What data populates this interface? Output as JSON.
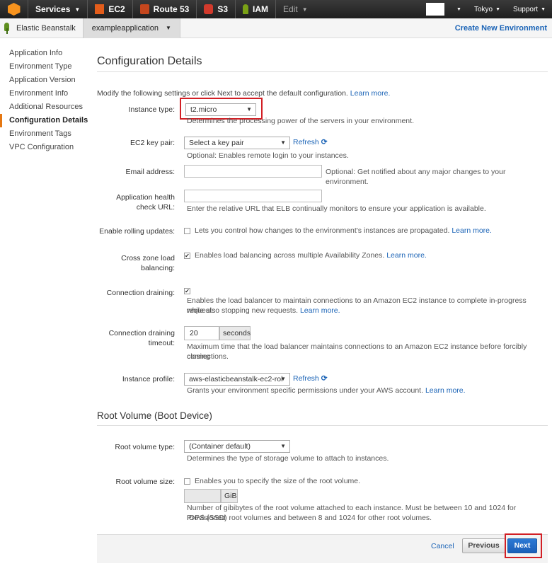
{
  "topnav": {
    "services": "Services",
    "ec2": "EC2",
    "route53": "Route 53",
    "s3": "S3",
    "iam": "IAM",
    "edit": "Edit",
    "region": "Tokyo",
    "support": "Support"
  },
  "subnav": {
    "service": "Elastic Beanstalk",
    "application": "exampleapplication",
    "create": "Create New Environment"
  },
  "sidebar": {
    "items": [
      {
        "label": "Application Info"
      },
      {
        "label": "Environment Type"
      },
      {
        "label": "Application Version"
      },
      {
        "label": "Environment Info"
      },
      {
        "label": "Additional Resources"
      },
      {
        "label": "Configuration Details",
        "active": true
      },
      {
        "label": "Environment Tags"
      },
      {
        "label": "VPC Configuration"
      }
    ]
  },
  "main": {
    "title": "Configuration Details",
    "intro": "Modify the following settings or click Next to accept the default configuration.",
    "learn_more": "Learn more.",
    "fields": {
      "instance_type": {
        "label": "Instance type:",
        "value": "t2.micro",
        "help": "Determines the processing power of the servers in your environment."
      },
      "key_pair": {
        "label": "EC2 key pair:",
        "value": "Select a key pair",
        "refresh": "Refresh",
        "help": "Optional: Enables remote login to your instances."
      },
      "email": {
        "label": "Email address:",
        "help": "Optional: Get notified about any major changes to your environment."
      },
      "health_check": {
        "label": "Application health check URL:",
        "help": "Enter the relative URL that ELB continually monitors to ensure your application is available."
      },
      "rolling": {
        "label": "Enable rolling updates:",
        "checked": false,
        "help": "Lets you control how changes to the environment's instances are propagated.",
        "learn_more": "Learn more."
      },
      "cross_zone": {
        "label": "Cross zone load balancing:",
        "checked": true,
        "help": "Enables load balancing across multiple Availability Zones.",
        "learn_more": "Learn more."
      },
      "draining": {
        "label": "Connection draining:",
        "checked": true,
        "help1": "Enables the load balancer to maintain connections to an Amazon EC2 instance to complete in-progress requests",
        "help2": "while also stopping new requests.",
        "learn_more": "Learn more."
      },
      "draining_timeout": {
        "label": "Connection draining timeout:",
        "value": "20",
        "unit": "seconds",
        "help1": "Maximum time that the load balancer maintains connections to an Amazon EC2 instance before forcibly closing",
        "help2": "connections."
      },
      "instance_profile": {
        "label": "Instance profile:",
        "value": "aws-elasticbeanstalk-ec2-rol",
        "refresh": "Refresh",
        "help": "Grants your environment specific permissions under your AWS account.",
        "learn_more": "Learn more."
      }
    }
  },
  "root_volume": {
    "title": "Root Volume (Boot Device)",
    "type": {
      "label": "Root volume type:",
      "value": "(Container default)",
      "help": "Determines the type of storage volume to attach to instances."
    },
    "size": {
      "label": "Root volume size:",
      "checked": false,
      "check_text": "Enables you to specify the size of the root volume.",
      "unit": "GiB",
      "help1": "Number of gibibytes of the root volume attached to each instance. Must be between 10 and 1024 for Provisioned",
      "help2": "IOPS (SSD) root volumes and between 8 and 1024 for other root volumes."
    }
  },
  "footer": {
    "cancel": "Cancel",
    "previous": "Previous",
    "next": "Next"
  },
  "colors": {
    "accent": "#1a63b6",
    "highlight": "#d21f25",
    "active_marker": "#e57712",
    "next_button": "#1c5fb8"
  }
}
